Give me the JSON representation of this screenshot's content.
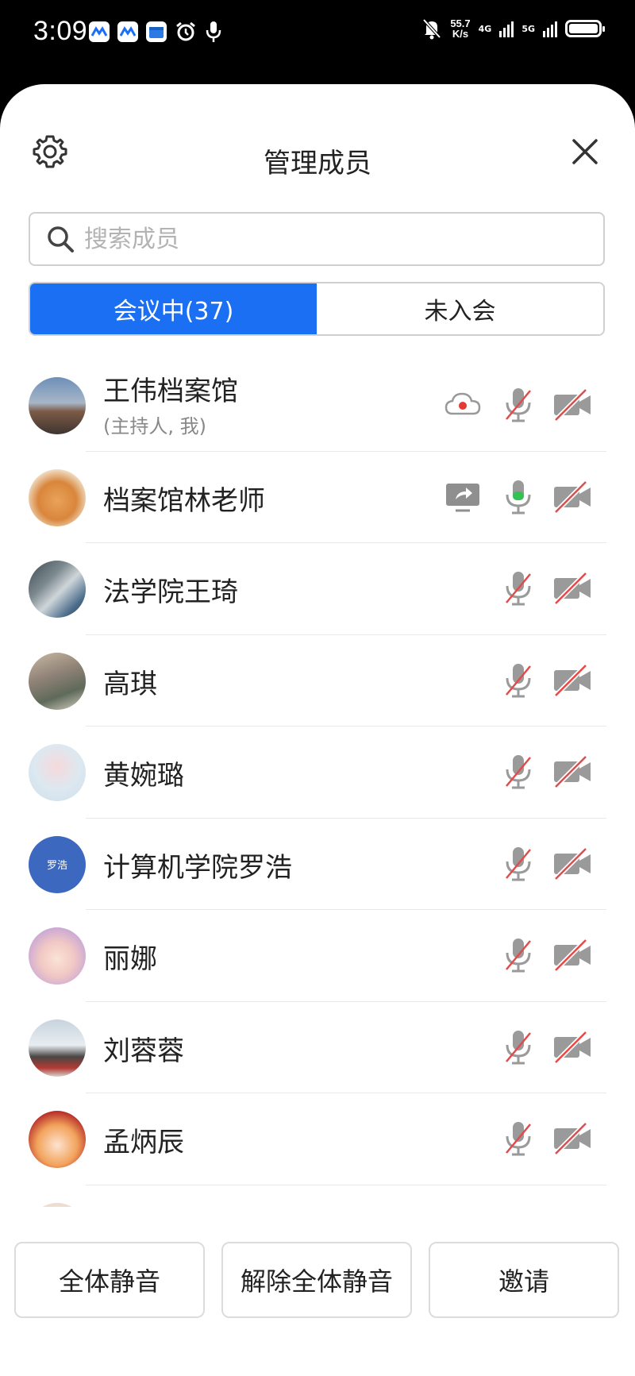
{
  "status_bar": {
    "time": "3:09",
    "net_speed_value": "55.7",
    "net_speed_unit": "K/s",
    "network_1": "4G",
    "network_2": "5G"
  },
  "header": {
    "title": "管理成员"
  },
  "search": {
    "placeholder": "搜索成员",
    "value": ""
  },
  "tabs": [
    {
      "label": "会议中(37)",
      "active": true
    },
    {
      "label": "未入会",
      "active": false
    }
  ],
  "members": [
    {
      "name": "王伟档案馆",
      "role": "(主持人, 我)",
      "avatar_text": "",
      "extra_icon": "cloud-record-icon",
      "mic": "muted",
      "camera": "off"
    },
    {
      "name": "档案馆林老师",
      "role": "",
      "avatar_text": "",
      "extra_icon": "screen-share-icon",
      "mic": "on",
      "camera": "off"
    },
    {
      "name": "法学院王琦",
      "role": "",
      "avatar_text": "",
      "extra_icon": "",
      "mic": "muted",
      "camera": "off"
    },
    {
      "name": "高琪",
      "role": "",
      "avatar_text": "",
      "extra_icon": "",
      "mic": "muted",
      "camera": "off"
    },
    {
      "name": "黄婉璐",
      "role": "",
      "avatar_text": "",
      "extra_icon": "",
      "mic": "muted",
      "camera": "off"
    },
    {
      "name": "计算机学院罗浩",
      "role": "",
      "avatar_text": "罗浩",
      "extra_icon": "",
      "mic": "muted",
      "camera": "off"
    },
    {
      "name": "丽娜",
      "role": "",
      "avatar_text": "",
      "extra_icon": "",
      "mic": "muted",
      "camera": "off"
    },
    {
      "name": "刘蓉蓉",
      "role": "",
      "avatar_text": "",
      "extra_icon": "",
      "mic": "muted",
      "camera": "off"
    },
    {
      "name": "孟炳辰",
      "role": "",
      "avatar_text": "",
      "extra_icon": "",
      "mic": "muted",
      "camera": "off"
    }
  ],
  "footer": {
    "mute_all_label": "全体静音",
    "unmute_all_label": "解除全体静音",
    "invite_label": "邀请"
  },
  "colors": {
    "accent": "#1a6ff2",
    "mic_on": "#35c255",
    "muted_slash": "#e24b4b",
    "record": "#e53935"
  }
}
